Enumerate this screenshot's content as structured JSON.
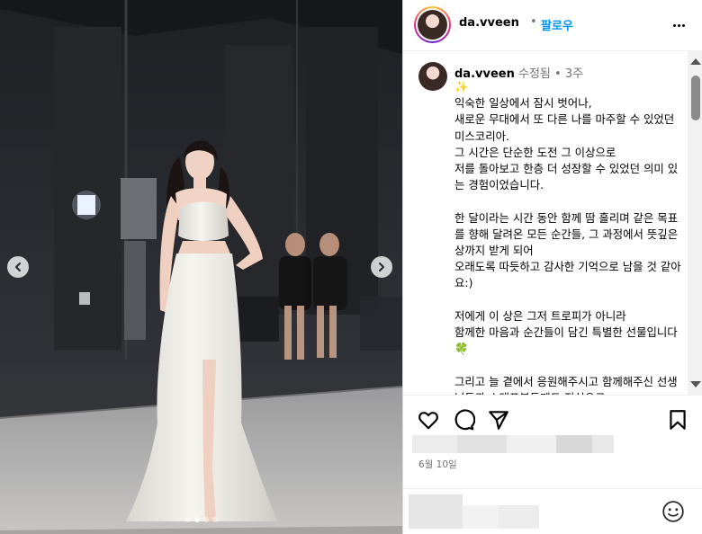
{
  "header": {
    "username": "da.vveen",
    "separator": "•",
    "follow_label": "팔로우",
    "more_icon": "more-horizontal-icon"
  },
  "caption": {
    "username": "da.vveen",
    "edited": "수정됨",
    "separator": "•",
    "time": "3주",
    "text": "✨\n익숙한 일상에서 잠시 벗어나,\n새로운 무대에서 또 다른 나를 마주할 수 있었던 미스코리아.\n그 시간은 단순한 도전 그 이상으로\n저를 돌아보고 한층 더 성장할 수 있었던 의미 있는 경험이었습니다.\n\n한 달이라는 시간 동안 함께 땀 흘리며 같은 목표를 향해 달려온 모든 순간들, 그 과정에서 뜻깊은 상까지 받게 되어\n오래도록 따듯하고 감사한 기억으로 남을 것 같아요:)\n\n저에게 이 상은 그저 트로피가 아니라\n함께한 마음과 순간들이 담긴 특별한 선물입니다 🍀\n\n그리고 늘 곁에서 응원해주시고 함께해주신 선생님들과 스태프분들께도 진심으로"
  },
  "actions": {
    "like_icon": "heart-icon",
    "comment_icon": "comment-icon",
    "share_icon": "share-icon",
    "save_icon": "bookmark-icon",
    "date": "6월 10일"
  },
  "comment": {
    "emoji_icon": "emoji-icon"
  },
  "media": {
    "prev_icon": "chevron-left-icon",
    "next_icon": "chevron-right-icon",
    "slide_count": 4,
    "active_slide": 1
  },
  "colors": {
    "accent": "#0095f6",
    "secondary_text": "#737373",
    "border": "#dbdbdb"
  }
}
